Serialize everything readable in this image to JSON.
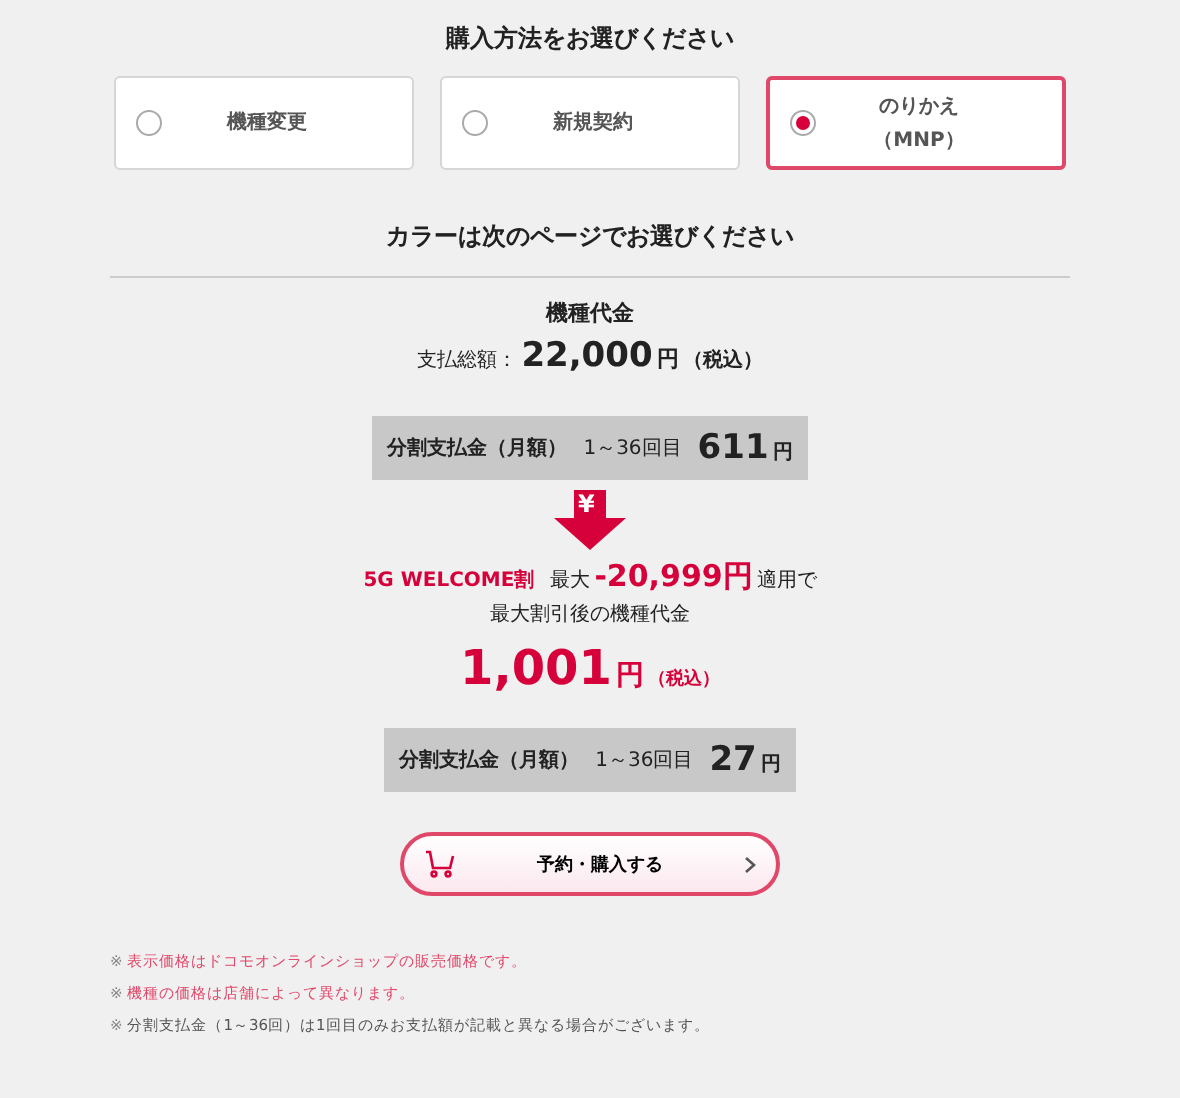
{
  "purchase_heading": "購入方法をお選びください",
  "options": [
    {
      "lines": [
        "機種変更"
      ],
      "selected": false
    },
    {
      "lines": [
        "新規契約"
      ],
      "selected": false
    },
    {
      "lines": [
        "のりかえ",
        "（MNP）"
      ],
      "selected": true
    }
  ],
  "color_note": "カラーは次のページでお選びください",
  "price_title": "機種代金",
  "total": {
    "label": "支払総額：",
    "amount": "22,000",
    "unit": "円",
    "tax": "（税込）"
  },
  "installment": {
    "label": "分割支払金（月額）",
    "range": "1～36回目",
    "amount": "611",
    "unit": "円"
  },
  "arrow_symbol": "¥",
  "discount": {
    "name": "5G WELCOME割",
    "prefix": "最大",
    "amount": "-20,999円",
    "suffix": "適用で"
  },
  "after_label": "最大割引後の機種代金",
  "final": {
    "amount": "1,001",
    "unit": "円",
    "tax": "（税込）"
  },
  "installment_after": {
    "label": "分割支払金（月額）",
    "range": "1～36回目",
    "amount": "27",
    "unit": "円"
  },
  "buy_button": "予約・購入する",
  "notes": [
    {
      "mark": "※",
      "text": "表示価格はドコモオンラインショップの販売価格です。",
      "kind": "alert"
    },
    {
      "mark": "※",
      "text": "機種の価格は店舗によって異なります。",
      "kind": "alert"
    },
    {
      "mark": "※",
      "text": "分割支払金（1～36回）は1回目のみお支払額が記載と異なる場合がございます。",
      "kind": "plain"
    }
  ]
}
